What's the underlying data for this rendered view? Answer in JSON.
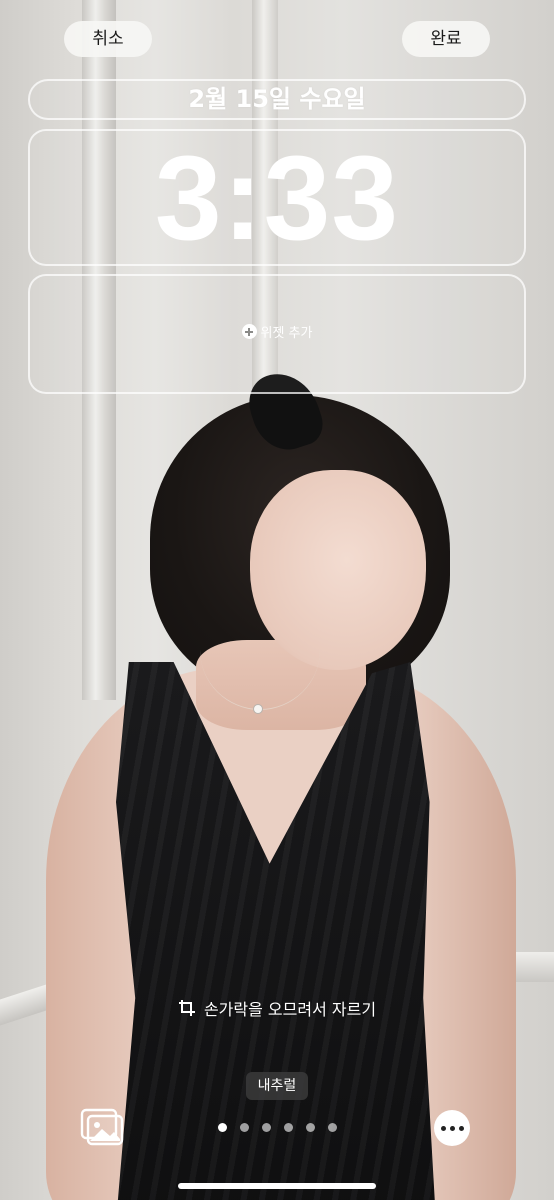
{
  "top_bar": {
    "cancel_label": "취소",
    "done_label": "완료"
  },
  "lock_screen": {
    "date": "2월 15일 수요일",
    "time": "3:33",
    "widget_add_label": "위젯 추가"
  },
  "crop_hint": "손가락을 오므려서 자르기",
  "filter_label": "내추럴",
  "pager": {
    "total": 6,
    "active_index": 0
  },
  "icons": {
    "photos": "photo-library-icon",
    "more": "ellipsis-icon",
    "crop": "crop-icon",
    "plus": "plus-circle-icon"
  }
}
